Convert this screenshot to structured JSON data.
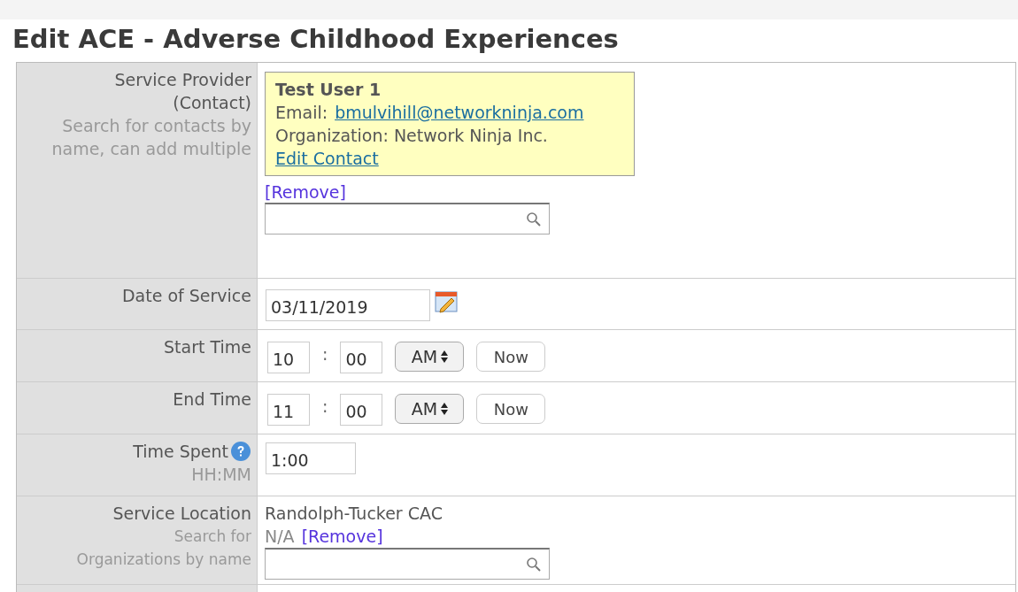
{
  "title": "Edit ACE - Adverse Childhood Experiences",
  "provider": {
    "label": "Service Provider (Contact)",
    "hint": "Search for contacts by name, can add multiple",
    "contact": {
      "name": "Test User 1",
      "email_label": "Email:",
      "email": "bmulvihill@networkninja.com",
      "org": "Organization: Network Ninja Inc.",
      "edit_link": "Edit Contact"
    },
    "remove": "[Remove]"
  },
  "date": {
    "label": "Date of Service",
    "value": "03/11/2019"
  },
  "times": [
    {
      "label": "Start Time",
      "hour": "10",
      "sep": ":",
      "minute": "00",
      "ampm": "AM",
      "now": "Now"
    },
    {
      "label": "End Time",
      "hour": "11",
      "sep": ":",
      "minute": "00",
      "ampm": "AM",
      "now": "Now"
    }
  ],
  "time_spent": {
    "label": "Time Spent",
    "hint": "HH:MM",
    "value": "1:00"
  },
  "location": {
    "label": "Service Location",
    "hint": "Search for Organizations by name",
    "value": "Randolph-Tucker CAC",
    "sub": "N/A",
    "remove": "[Remove]"
  }
}
